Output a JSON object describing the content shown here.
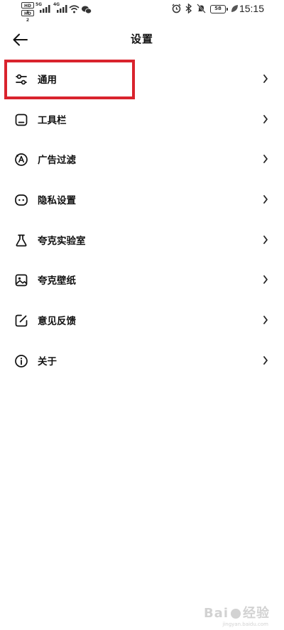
{
  "status_bar": {
    "sim1_tag": "HD 1",
    "sim2_tag": "HD 2",
    "net1": "5G",
    "net2": "4G",
    "battery": "58",
    "time": "15:15"
  },
  "header": {
    "title": "设置"
  },
  "menu": {
    "items": [
      {
        "label": "通用",
        "icon": "sliders-icon"
      },
      {
        "label": "工具栏",
        "icon": "toolbar-icon"
      },
      {
        "label": "广告过滤",
        "icon": "ad-filter-icon"
      },
      {
        "label": "隐私设置",
        "icon": "privacy-icon"
      },
      {
        "label": "夸克实验室",
        "icon": "flask-icon"
      },
      {
        "label": "夸克壁纸",
        "icon": "wallpaper-icon"
      },
      {
        "label": "意见反馈",
        "icon": "feedback-icon"
      },
      {
        "label": "关于",
        "icon": "info-icon"
      }
    ]
  },
  "highlight_color": "#d9232d",
  "watermark": {
    "text": "Bai",
    "text2": "经验",
    "sub": "jingyan.baidu.com"
  }
}
